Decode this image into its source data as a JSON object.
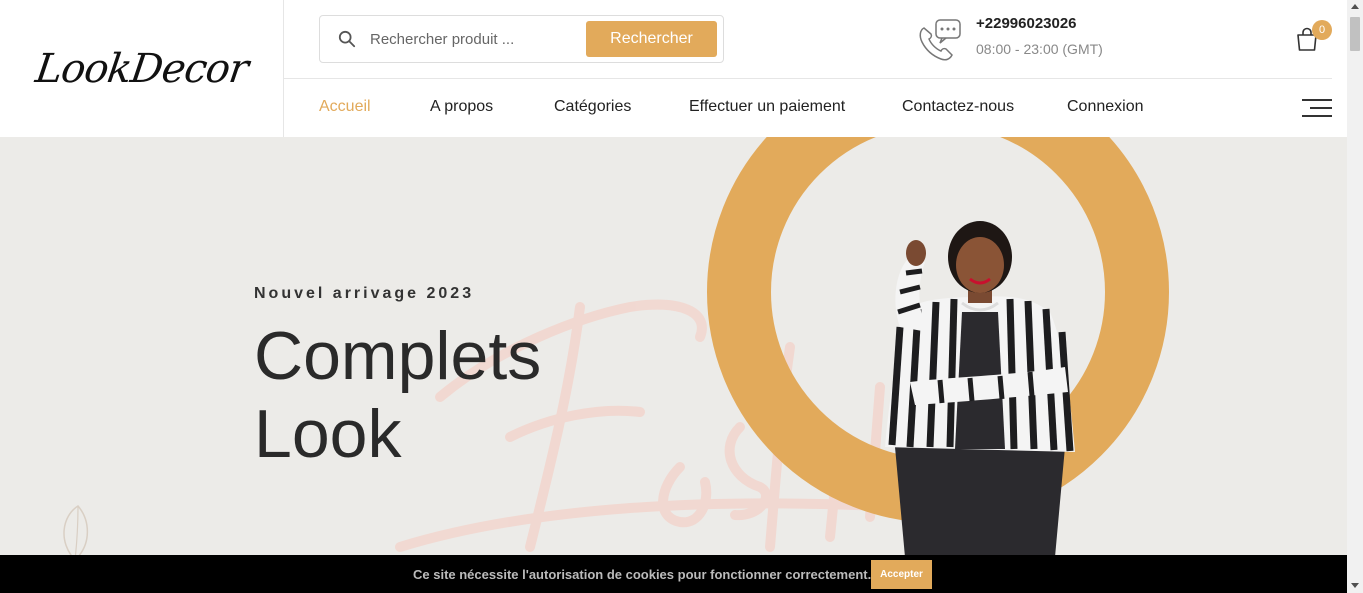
{
  "brand": {
    "logo_text": "LookDecor"
  },
  "search": {
    "placeholder": "Rechercher produit ...",
    "button_label": "Rechercher"
  },
  "contact": {
    "phone": "+22996023026",
    "hours": "08:00 - 23:00 (GMT)"
  },
  "cart": {
    "count": "0"
  },
  "nav": {
    "items": [
      {
        "label": "Accueil",
        "active": true
      },
      {
        "label": "A propos",
        "active": false
      },
      {
        "label": "Catégories",
        "active": false
      },
      {
        "label": "Effectuer un paiement",
        "active": false
      },
      {
        "label": "Contactez-nous",
        "active": false
      },
      {
        "label": "Connexion",
        "active": false
      }
    ]
  },
  "hero": {
    "subtitle": "Nouvel arrivage 2023",
    "title_line1": "Complets",
    "title_line2": "Look"
  },
  "cookie": {
    "message": "Ce site nécessite l'autorisation de cookies pour fonctionner correctement.",
    "accept_label": "Accepter"
  },
  "colors": {
    "accent": "#e2aa5b",
    "hero_bg": "#ecebe8",
    "text_dark": "#2a2a2a"
  }
}
